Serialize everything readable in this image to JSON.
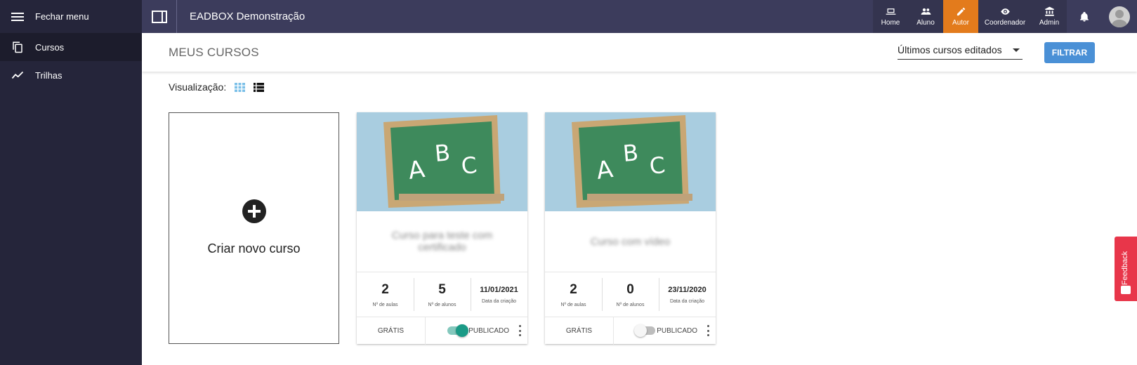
{
  "colors": {
    "sidebar_bg": "#25253a",
    "topbar_bg": "#3c3c5c",
    "accent_orange": "#e37b1c",
    "filter_blue": "#4a90d6",
    "feedback_red": "#e8364a",
    "toggle_on": "#1a9a86"
  },
  "sidebar": {
    "close_menu_label": "Fechar menu",
    "close_menu_icon": "hamburger-icon",
    "items": [
      {
        "label": "Cursos",
        "icon": "copy-icon",
        "active": true
      },
      {
        "label": "Trilhas",
        "icon": "trend-icon",
        "active": false
      }
    ]
  },
  "topbar": {
    "app_title": "EADBOX Demonstração",
    "nav": [
      {
        "label": "Home",
        "icon": "laptop-icon",
        "active": false
      },
      {
        "label": "Aluno",
        "icon": "people-icon",
        "active": false
      },
      {
        "label": "Autor",
        "icon": "pencil-icon",
        "active": true
      },
      {
        "label": "Coordenador",
        "icon": "eye-icon",
        "active": false
      },
      {
        "label": "Admin",
        "icon": "bank-icon",
        "active": false
      }
    ],
    "notification_icon": "bell-icon",
    "avatar_icon": "avatar-icon"
  },
  "header": {
    "page_title": "MEUS CURSOS",
    "sort_selected": "Últimos cursos editados",
    "filter_label": "FILTRAR"
  },
  "view": {
    "label": "Visualização:",
    "grid_icon": "grid-view-icon",
    "list_icon": "list-view-icon"
  },
  "new_course": {
    "label": "Criar novo curso",
    "icon": "plus-circle-icon"
  },
  "courses": [
    {
      "name": "Curso para teste com certificado",
      "lessons": "2",
      "lessons_label": "Nº de aulas",
      "students": "5",
      "students_label": "Nº de alunos",
      "created": "11/01/2021",
      "created_label": "Data da criação",
      "price": "GRÁTIS",
      "published_label": "PUBLICADO",
      "published": true
    },
    {
      "name": "Curso com vídeo",
      "lessons": "2",
      "lessons_label": "Nº de aulas",
      "students": "0",
      "students_label": "Nº de alunos",
      "created": "23/11/2020",
      "created_label": "Data da criação",
      "price": "GRÁTIS",
      "published_label": "PUBLICADO",
      "published": false
    }
  ],
  "feedback": {
    "label": "Feedback",
    "icon": "feedback-icon"
  }
}
